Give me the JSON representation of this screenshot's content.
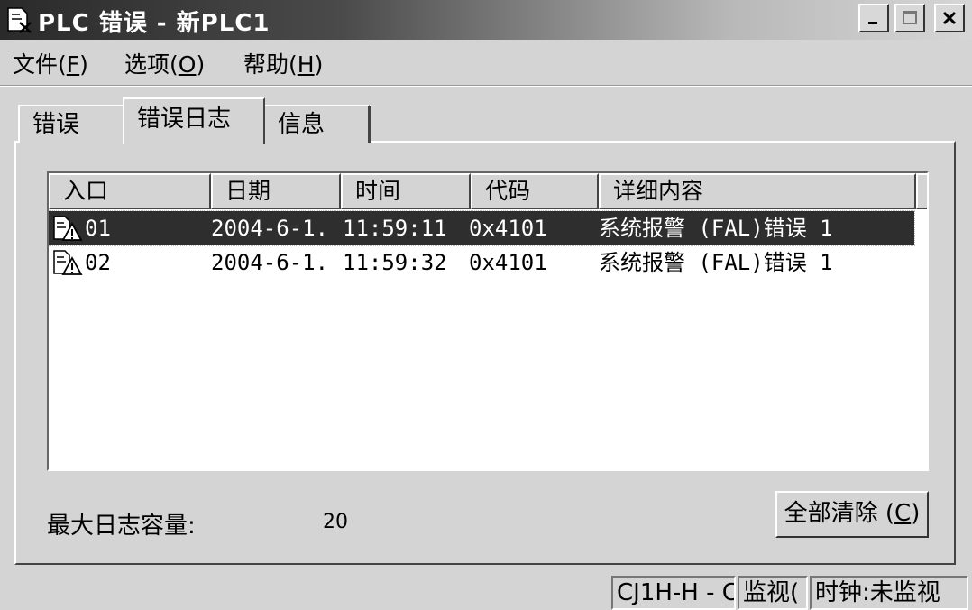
{
  "window": {
    "title": "PLC 错误 - 新PLC1",
    "controls": {
      "minimize": "_",
      "maximize": "□",
      "close": "X"
    }
  },
  "menu": [
    {
      "label": "文件(",
      "accel": "F",
      "tail": ")"
    },
    {
      "label": "选项(",
      "accel": "O",
      "tail": ")"
    },
    {
      "label": "帮助(",
      "accel": "H",
      "tail": ")"
    }
  ],
  "tabs": [
    {
      "label": "错误",
      "selected": false
    },
    {
      "label": "错误日志",
      "selected": true
    },
    {
      "label": "信息",
      "selected": false
    }
  ],
  "table": {
    "columns": [
      "入口",
      "日期",
      "时间",
      "代码",
      "详细内容"
    ],
    "rows": [
      {
        "entry": "01",
        "date": "2004-6-1.",
        "time": "11:59:11",
        "code": "0x4101",
        "detail": "系统报警 (FAL)错误 1",
        "selected": true
      },
      {
        "entry": "02",
        "date": "2004-6-1.",
        "time": "11:59:32",
        "code": "0x4101",
        "detail": "系统报警 (FAL)错误 1",
        "selected": false
      }
    ]
  },
  "max_log": {
    "label": "最大日志容量:",
    "value": "20"
  },
  "clear_button": {
    "label": "全部清除 (",
    "accel": "C",
    "tail": ")"
  },
  "status": [
    "CJ1H-H - C",
    "监视(",
    "时钟:未监视"
  ],
  "colors": {
    "selection": "#2e2e2e",
    "face": "#d4d4d4"
  },
  "icons": {
    "app": "plc-error-icon",
    "row": "warning-document-icon"
  }
}
